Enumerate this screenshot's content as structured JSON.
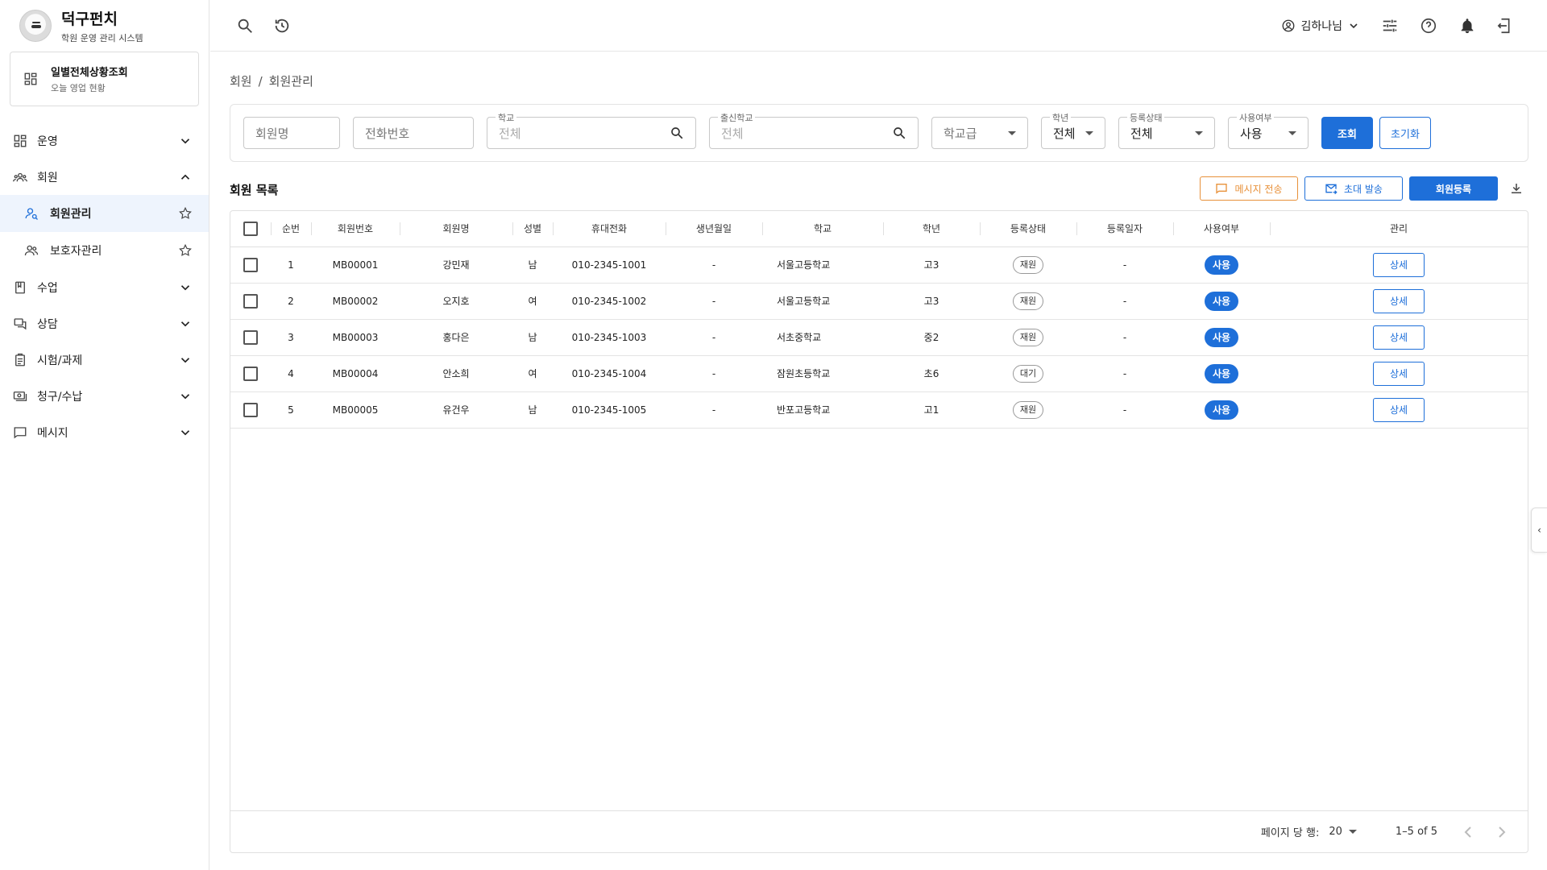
{
  "brand": {
    "title": "덕구펀치",
    "subtitle": "학원 운영 관리 시스템"
  },
  "daily": {
    "title": "일별전체상황조회",
    "subtitle": "오늘 영업 현황"
  },
  "nav": {
    "operation": "운영",
    "member": "회원",
    "member_manage": "회원관리",
    "guardian_manage": "보호자관리",
    "class": "수업",
    "counsel": "상담",
    "exam": "시험/과제",
    "billing": "청구/수납",
    "message": "메시지"
  },
  "topbar": {
    "user_name": "김하나님"
  },
  "breadcrumb": {
    "root": "회원",
    "sep": "/",
    "current": "회원관리"
  },
  "filters": {
    "member_name_placeholder": "회원명",
    "phone_placeholder": "전화번호",
    "school_label": "학교",
    "school_placeholder": "전체",
    "origin_school_label": "출신학교",
    "origin_school_placeholder": "전체",
    "school_level": "학교급",
    "grade_label": "학년",
    "grade_value": "전체",
    "status_label": "등록상태",
    "status_value": "전체",
    "use_label": "사용여부",
    "use_value": "사용",
    "search_button": "조회",
    "reset_button": "초기화"
  },
  "list": {
    "title": "회원 목록",
    "send_message": "메시지 전송",
    "send_invite": "초대 발송",
    "register": "회원등록"
  },
  "table": {
    "columns": [
      "순번",
      "회원번호",
      "회원명",
      "성별",
      "휴대전화",
      "생년월일",
      "학교",
      "학년",
      "등록상태",
      "등록일자",
      "사용여부",
      "관리"
    ],
    "detail_label": "상세",
    "rows": [
      {
        "no": "1",
        "id": "MB00001",
        "name": "강민재",
        "gender": "남",
        "phone": "010-2345-1001",
        "birth": "-",
        "school": "서울고등학교",
        "grade": "고3",
        "status": "재원",
        "reg_date": "-",
        "use": "사용"
      },
      {
        "no": "2",
        "id": "MB00002",
        "name": "오지호",
        "gender": "여",
        "phone": "010-2345-1002",
        "birth": "-",
        "school": "서울고등학교",
        "grade": "고3",
        "status": "재원",
        "reg_date": "-",
        "use": "사용"
      },
      {
        "no": "3",
        "id": "MB00003",
        "name": "홍다은",
        "gender": "남",
        "phone": "010-2345-1003",
        "birth": "-",
        "school": "서초중학교",
        "grade": "중2",
        "status": "재원",
        "reg_date": "-",
        "use": "사용"
      },
      {
        "no": "4",
        "id": "MB00004",
        "name": "안소희",
        "gender": "여",
        "phone": "010-2345-1004",
        "birth": "-",
        "school": "잠원초등학교",
        "grade": "초6",
        "status": "대기",
        "reg_date": "-",
        "use": "사용"
      },
      {
        "no": "5",
        "id": "MB00005",
        "name": "유건우",
        "gender": "남",
        "phone": "010-2345-1005",
        "birth": "-",
        "school": "반포고등학교",
        "grade": "고1",
        "status": "재원",
        "reg_date": "-",
        "use": "사용"
      }
    ]
  },
  "pager": {
    "rows_per_page_label": "페이지 당 행:",
    "rows_per_page": "20",
    "range": "1–5 of 5"
  },
  "edge_tab": {
    "glyph": "‹"
  },
  "colors": {
    "primary": "#1e6fd9",
    "orange": "#e8913a",
    "active_bg": "#eef4fd"
  }
}
